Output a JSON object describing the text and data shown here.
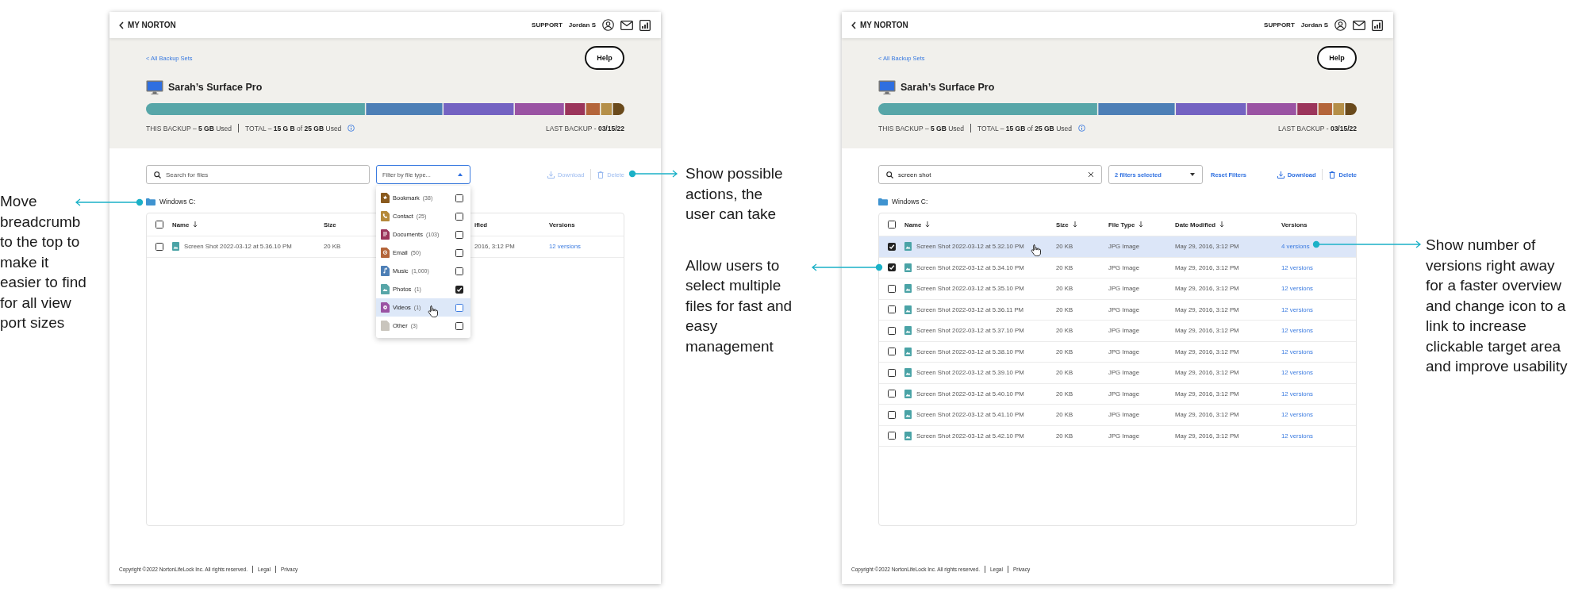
{
  "screens": [
    {
      "header": {
        "back_label": "MY NORTON",
        "support": "SUPPORT",
        "user": "Jordan S"
      },
      "breadcrumb": "< All Backup Sets",
      "help": "Help",
      "device": "Sarah’s Surface Pro",
      "this_backup": "THIS BACKUP – **5 GB** Used",
      "total": "TOTAL – **15 G B** of **25 GB** Used",
      "last_backup": "LAST BACKUP - **03/15/22**",
      "search": {
        "placeholder": "Search for files"
      },
      "filter": {
        "placeholder": "Filter by file type...",
        "expanded": true
      },
      "filter_menu": [
        {
          "kind": "bookmark",
          "label": "Bookmark",
          "count": "(38)",
          "checked": false,
          "highlighted": false,
          "color": "#8a5a1e"
        },
        {
          "kind": "contact",
          "label": "Contact",
          "count": "(25)",
          "checked": false,
          "highlighted": false,
          "color": "#b5893a"
        },
        {
          "kind": "documents",
          "label": "Documents",
          "count": "(103)",
          "checked": false,
          "highlighted": false,
          "color": "#9b355b"
        },
        {
          "kind": "email",
          "label": "Email",
          "count": "(50)",
          "checked": false,
          "highlighted": false,
          "color": "#b4653a"
        },
        {
          "kind": "music",
          "label": "Music",
          "count": "(1,000)",
          "checked": false,
          "highlighted": false,
          "color": "#4d7fb6"
        },
        {
          "kind": "photos",
          "label": "Photos",
          "count": "(1)",
          "checked": true,
          "highlighted": false,
          "color": "#57a6a8"
        },
        {
          "kind": "videos",
          "label": "Videos",
          "count": "(1)",
          "checked": false,
          "highlighted": true,
          "color": "#9a53a3"
        },
        {
          "kind": "other",
          "label": "Other",
          "count": "(3)",
          "checked": false,
          "highlighted": false,
          "color": "#c9c5bd"
        }
      ],
      "actions": [
        {
          "kind": "download",
          "label": "Download",
          "disabled": true
        },
        {
          "kind": "delete",
          "label": "Delete",
          "disabled": true
        }
      ],
      "folder": "Windows C:",
      "table": {
        "select_all_checked": false,
        "columns": [
          {
            "kind": "name",
            "label": "Name",
            "sorted": true
          },
          {
            "kind": "size",
            "label": "Size",
            "sorted": false
          },
          {
            "kind": "cut",
            "label": "ified",
            "sorted": false
          },
          {
            "kind": "versions",
            "label": "Versions",
            "sorted": false
          }
        ],
        "rows": [
          {
            "checked": false,
            "selected": false,
            "cells": [
              "Screen Shot 2022-03-12 at 5.36.10 PM",
              "20 KB",
              "2016, 3:12 PM",
              "12 versions"
            ]
          }
        ]
      },
      "footer": {
        "copyright": "Copyright ©2022 NortonLifeLock Inc. All rights reserved.",
        "links": [
          "Legal",
          "Privacy"
        ]
      }
    },
    {
      "header": {
        "back_label": "MY NORTON",
        "support": "SUPPORT",
        "user": "Jordan S"
      },
      "breadcrumb": "< All Backup Sets",
      "help": "Help",
      "device": "Sarah’s Surface Pro",
      "this_backup": "THIS BACKUP – **5 GB** Used",
      "total": "TOTAL – **15 GB** of **25 GB** Used",
      "last_backup": "LAST BACKUP - **03/15/22**",
      "search": {
        "value": "screen shot"
      },
      "filter": {
        "value": "2 filters selected",
        "expanded": false
      },
      "reset_link": "Reset Filters",
      "actions": [
        {
          "kind": "download",
          "label": "Download",
          "disabled": false
        },
        {
          "kind": "delete",
          "label": "Delete",
          "disabled": false
        }
      ],
      "folder": "Windows C:",
      "table": {
        "select_all_checked": false,
        "columns": [
          {
            "kind": "name",
            "label": "Name",
            "sorted": true
          },
          {
            "kind": "size",
            "label": "Size",
            "sorted": true
          },
          {
            "kind": "type",
            "label": "File Type",
            "sorted": true
          },
          {
            "kind": "date",
            "label": "Date Modified",
            "sorted": true
          },
          {
            "kind": "versions",
            "label": "Versions",
            "sorted": false
          }
        ],
        "rows": [
          {
            "checked": true,
            "selected": true,
            "cells": [
              "Screen Shot 2022-03-12 at 5.32.10 PM",
              "20 KB",
              "JPG Image",
              "May 29, 2016, 3:12 PM",
              "4 versions"
            ]
          },
          {
            "checked": true,
            "selected": false,
            "cells": [
              "Screen Shot 2022-03-12 at 5.34.10 PM",
              "20 KB",
              "JPG Image",
              "May 29, 2016, 3:12 PM",
              "12 versions"
            ]
          },
          {
            "checked": false,
            "selected": false,
            "cells": [
              "Screen Shot 2022-03-12 at 5.35.10 PM",
              "20 KB",
              "JPG Image",
              "May 29, 2016, 3:12 PM",
              "12 versions"
            ]
          },
          {
            "checked": false,
            "selected": false,
            "cells": [
              "Screen Shot 2022-03-12 at 5.36.11 PM",
              "20 KB",
              "JPG Image",
              "May 29, 2016, 3:12 PM",
              "12 versions"
            ]
          },
          {
            "checked": false,
            "selected": false,
            "cells": [
              "Screen Shot 2022-03-12 at 5.37.10 PM",
              "20 KB",
              "JPG Image",
              "May 29, 2016, 3:12 PM",
              "12 versions"
            ]
          },
          {
            "checked": false,
            "selected": false,
            "cells": [
              "Screen Shot 2022-03-12 at 5.38.10 PM",
              "20 KB",
              "JPG Image",
              "May 29, 2016, 3:12 PM",
              "12 versions"
            ]
          },
          {
            "checked": false,
            "selected": false,
            "cells": [
              "Screen Shot 2022-03-12 at 5.39.10 PM",
              "20 KB",
              "JPG Image",
              "May 29, 2016, 3:12 PM",
              "12 versions"
            ]
          },
          {
            "checked": false,
            "selected": false,
            "cells": [
              "Screen Shot 2022-03-12 at 5.40.10 PM",
              "20 KB",
              "JPG Image",
              "May 29, 2016, 3:12 PM",
              "12 versions"
            ]
          },
          {
            "checked": false,
            "selected": false,
            "cells": [
              "Screen Shot 2022-03-12 at 5.41.10 PM",
              "20 KB",
              "JPG Image",
              "May 29, 2016, 3:12 PM",
              "12 versions"
            ]
          },
          {
            "checked": false,
            "selected": false,
            "cells": [
              "Screen Shot 2022-03-12 at 5.42.10 PM",
              "20 KB",
              "JPG Image",
              "May 29, 2016, 3:12 PM",
              "12 versions"
            ]
          }
        ]
      },
      "footer": {
        "copyright": "Copyright ©2022 NortonLifeLock Inc. All rights reserved.",
        "links": [
          "Legal",
          "Privacy"
        ]
      }
    }
  ],
  "annotations": {
    "left": [
      "Move breadcrumb to the top to make it easier to find for all view port sizes"
    ],
    "middle": [
      "Show possible actions, the user can take",
      "Allow users to select multiple files for fast and easy management"
    ],
    "right": [
      "Show number of versions right away for a faster overview and change icon to a link to increase clickable target area and improve usability"
    ]
  }
}
